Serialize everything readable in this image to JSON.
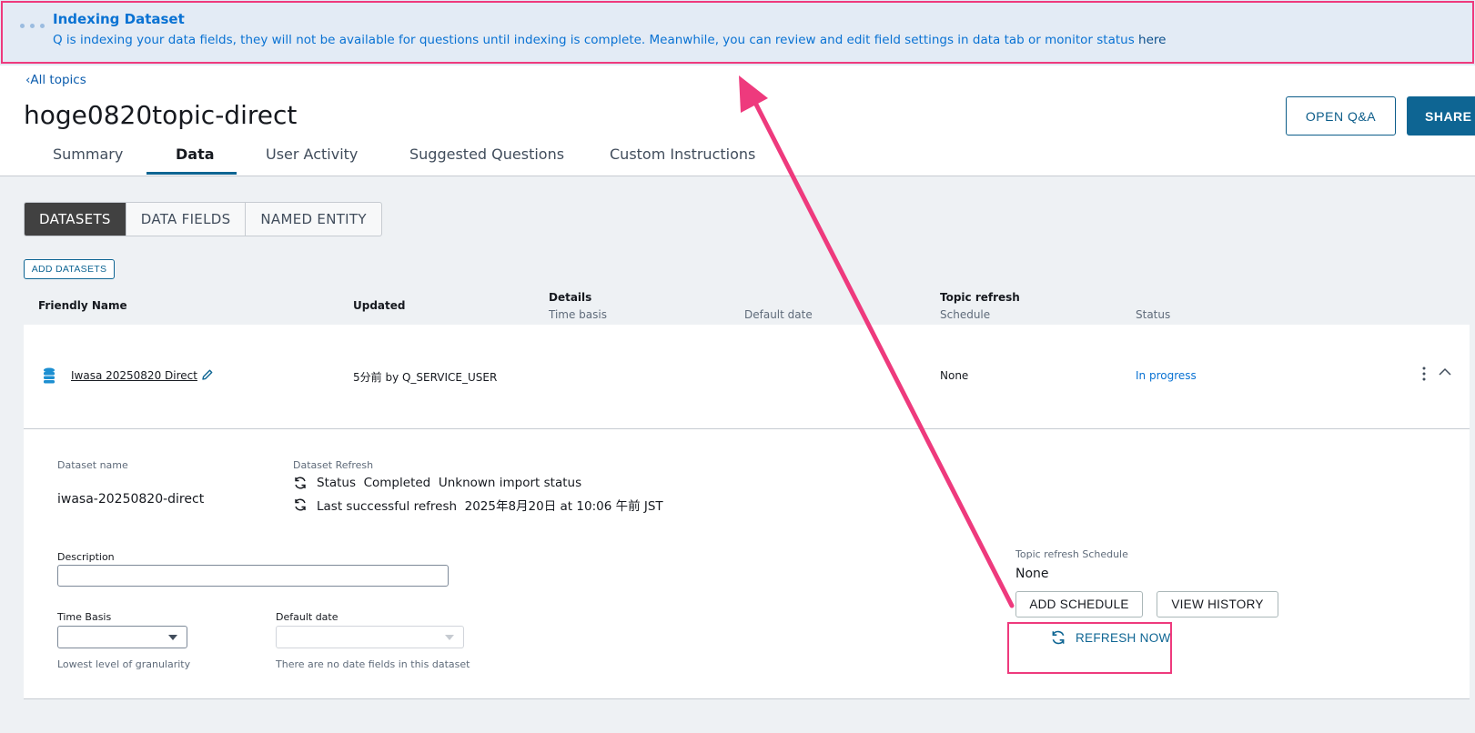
{
  "banner": {
    "title": "Indexing Dataset",
    "message": "Q is indexing your data fields, they will not be available for questions until indexing is complete. Meanwhile, you can review and edit field settings in data tab or monitor status ",
    "link": "here"
  },
  "header": {
    "back_label": "All topics",
    "title": "hoge0820topic-direct",
    "open_qa_label": "OPEN Q&A",
    "share_label": "SHARE"
  },
  "tabs": [
    {
      "label": "Summary",
      "active": false
    },
    {
      "label": "Data",
      "active": true
    },
    {
      "label": "User Activity",
      "active": false
    },
    {
      "label": "Suggested Questions",
      "active": false
    },
    {
      "label": "Custom Instructions",
      "active": false
    }
  ],
  "segments": [
    {
      "label": "DATASETS",
      "active": true
    },
    {
      "label": "DATA FIELDS",
      "active": false
    },
    {
      "label": "NAMED ENTITY",
      "active": false
    }
  ],
  "add_datasets_label": "ADD DATASETS",
  "table": {
    "headers": {
      "friendly_name": "Friendly Name",
      "updated": "Updated",
      "details": "Details",
      "time_basis": "Time basis",
      "default_date": "Default date",
      "topic_refresh": "Topic refresh",
      "schedule": "Schedule",
      "status": "Status"
    },
    "row": {
      "name": "Iwasa 20250820 Direct",
      "updated": "5分前 by Q_SERVICE_USER",
      "schedule": "None",
      "status": "In progress"
    }
  },
  "detail": {
    "dataset_name_label": "Dataset name",
    "dataset_name": "iwasa-20250820-direct",
    "dataset_refresh_label": "Dataset Refresh",
    "status_line": "Status  Completed  Unknown import status",
    "last_refresh_line": "Last successful refresh  2025年8月20日 at 10:06 午前 JST",
    "description_label": "Description",
    "description_value": "",
    "time_basis_label": "Time Basis",
    "time_basis_hint": "Lowest level of granularity",
    "default_date_label": "Default date",
    "default_date_hint": "There are no date fields in this dataset",
    "topic_refresh_schedule_label": "Topic refresh Schedule",
    "topic_refresh_schedule_value": "None",
    "add_schedule_label": "ADD SCHEDULE",
    "view_history_label": "VIEW HISTORY",
    "refresh_now_label": "REFRESH NOW"
  },
  "colors": {
    "annotation": "#ee3a7d",
    "accent": "#0e6593",
    "link": "#0972d3"
  }
}
